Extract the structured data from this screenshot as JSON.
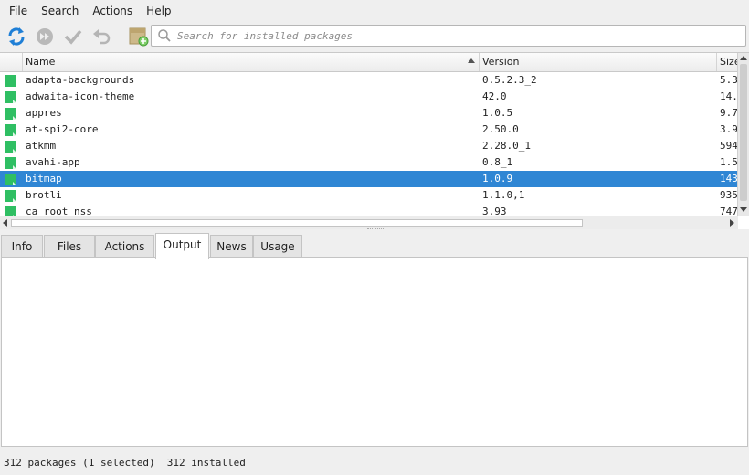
{
  "menu": {
    "file": {
      "u": "F",
      "rest": "ile"
    },
    "search": {
      "u": "S",
      "rest": "earch"
    },
    "actions": {
      "u": "A",
      "rest": "ctions"
    },
    "help": {
      "u": "H",
      "rest": "elp"
    }
  },
  "search": {
    "placeholder": "Search for installed packages",
    "value": ""
  },
  "columns": {
    "name": "Name",
    "version": "Version",
    "size": "Size"
  },
  "packages": [
    {
      "name": "adapta-backgrounds",
      "version": "0.5.2.3_2",
      "size": "5.3"
    },
    {
      "name": "adwaita-icon-theme",
      "version": "42.0",
      "size": "14."
    },
    {
      "name": "appres",
      "version": "1.0.5",
      "size": "9.7"
    },
    {
      "name": "at-spi2-core",
      "version": "2.50.0",
      "size": "3.9"
    },
    {
      "name": "atkmm",
      "version": "2.28.0_1",
      "size": "594"
    },
    {
      "name": "avahi-app",
      "version": "0.8_1",
      "size": "1.5"
    },
    {
      "name": "bitmap",
      "version": "1.0.9",
      "size": "143"
    },
    {
      "name": "brotli",
      "version": "1.1.0,1",
      "size": "935"
    },
    {
      "name": "ca_root_nss",
      "version": "3.93",
      "size": "747"
    }
  ],
  "tabs": [
    "Info",
    "Files",
    "Actions",
    "Output",
    "News",
    "Usage"
  ],
  "active_tab": "Output",
  "status": "312 packages (1 selected)  312 installed",
  "colors": {
    "selection": "#2f86d4",
    "package_icon": "#2fbf63",
    "refresh_icon": "#1f7fd6"
  },
  "icons": [
    "refresh-icon",
    "fast-forward-icon",
    "checkmark-icon",
    "undo-icon",
    "package-archive-icon",
    "search-icon"
  ]
}
